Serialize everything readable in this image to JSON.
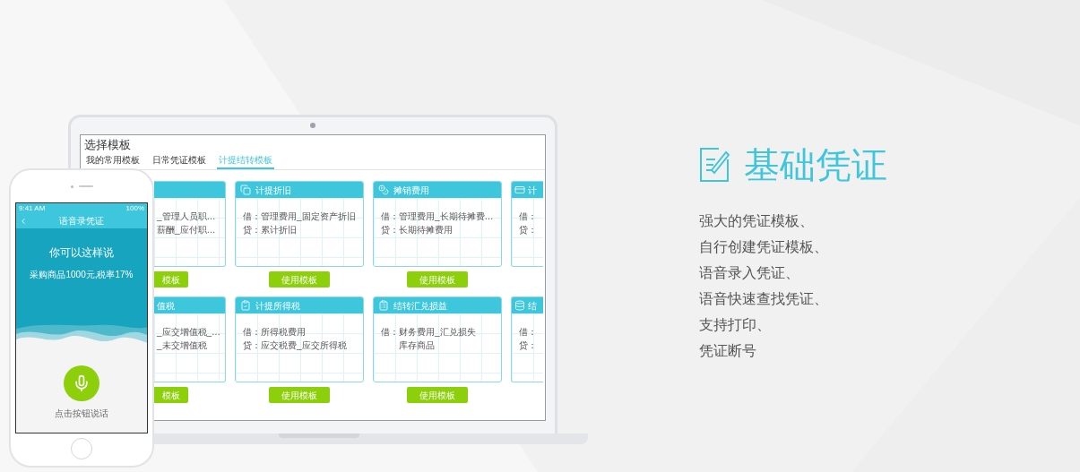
{
  "laptop": {
    "title": "选择模板",
    "tabs": [
      {
        "label": "我的常用模板",
        "selected": false
      },
      {
        "label": "日常凭证模板",
        "selected": false
      },
      {
        "label": "计提结转模板",
        "selected": true
      }
    ],
    "cards": [
      {
        "kind": "left",
        "lines": [
          "_管理人员职…",
          "薪酬_应付职…"
        ],
        "button": "模板"
      },
      {
        "kind": "full",
        "title": "计提折旧",
        "lines": [
          "借：管理费用_固定资产折旧",
          "贷：累计折旧"
        ],
        "button": "使用模板"
      },
      {
        "kind": "full",
        "title": "摊销费用",
        "lines": [
          "借：管理费用_长期待摊费…",
          "贷：长期待摊费用"
        ],
        "button": "使用模板"
      },
      {
        "kind": "right",
        "title": "计",
        "lines": [
          "借：",
          "贷："
        ]
      },
      {
        "kind": "left",
        "title": "值税",
        "lines": [
          "_应交增值税_…",
          "_未交增值税"
        ],
        "button": "模板"
      },
      {
        "kind": "full",
        "title": "计提所得税",
        "lines": [
          "借：所得税费用",
          "贷：应交税费_应交所得税"
        ],
        "button": "使用模板"
      },
      {
        "kind": "full",
        "title": "结转汇兑损益",
        "lines": [
          "借：财务费用_汇兑损失",
          "　　库存商品"
        ],
        "button": "使用模板"
      },
      {
        "kind": "right",
        "title": "结",
        "lines": [
          "借：",
          "贷："
        ]
      }
    ]
  },
  "phone": {
    "time": "9:41 AM",
    "battery": "100%",
    "title": "语音录凭证",
    "heading": "你可以这样说",
    "example": "采购商品1000元,税率17%",
    "hint": "点击按钮说话"
  },
  "feature": {
    "title": "基础凭证",
    "items": [
      "强大的凭证模板、",
      "自行创建凭证模板、",
      "语音录入凭证、",
      "语音快速查找凭证、",
      "支持打印、",
      "凭证断号"
    ]
  }
}
